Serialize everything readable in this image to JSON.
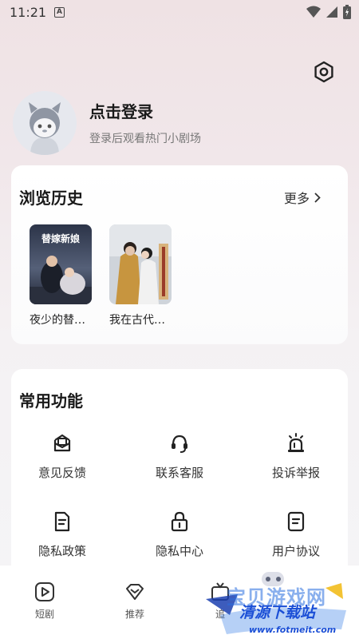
{
  "status_bar": {
    "time": "11:21",
    "notification_badge": "A"
  },
  "profile": {
    "login_title": "点击登录",
    "login_subtitle": "登录后观看热门小剧场"
  },
  "history": {
    "title": "浏览历史",
    "more_label": "更多",
    "items": [
      {
        "label": "夜少的替…",
        "poster_text": "替嫁新娘"
      },
      {
        "label": "我在古代…"
      }
    ]
  },
  "functions": {
    "title": "常用功能",
    "items": [
      {
        "label": "意见反馈",
        "icon": "feedback-icon"
      },
      {
        "label": "联系客服",
        "icon": "headset-icon"
      },
      {
        "label": "投诉举报",
        "icon": "alarm-icon"
      },
      {
        "label": "隐私政策",
        "icon": "document-icon"
      },
      {
        "label": "隐私中心",
        "icon": "lock-icon"
      },
      {
        "label": "用户协议",
        "icon": "agreement-icon"
      }
    ]
  },
  "tab_bar": {
    "items": [
      {
        "label": "短剧",
        "icon": "play-icon"
      },
      {
        "label": "推荐",
        "icon": "heart-diamond-icon"
      },
      {
        "label": "追",
        "icon": "tv-icon"
      }
    ]
  },
  "watermark": {
    "line1": "宝贝游戏网",
    "line2": "清源下载站",
    "line3": "www.fotmeit.com"
  },
  "colors": {
    "background_top": "#efe2e4",
    "card": "#ffffff",
    "text_primary": "#1a1a1a",
    "text_secondary": "#777777"
  }
}
